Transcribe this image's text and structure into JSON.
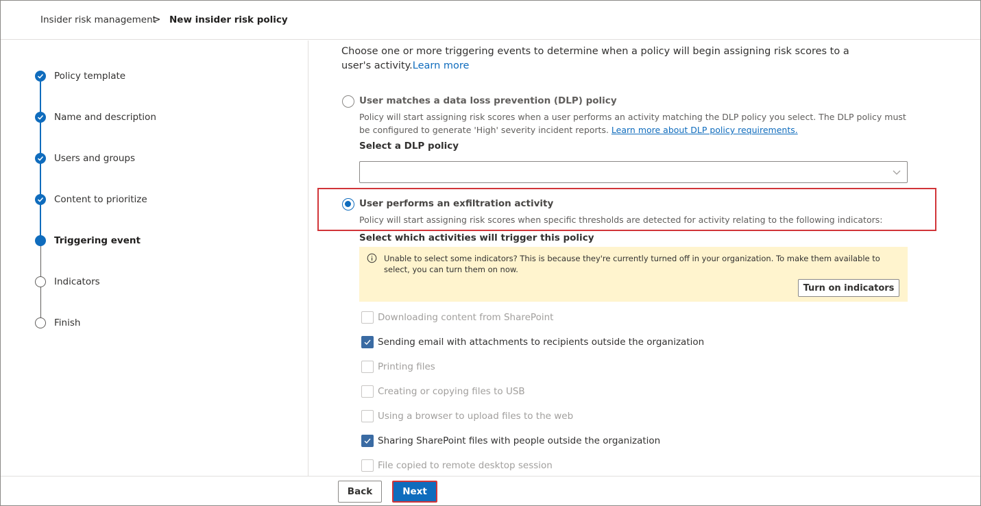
{
  "breadcrumb": {
    "parent": "Insider risk management",
    "separator": ">",
    "current": "New insider risk policy"
  },
  "steps": [
    {
      "label": "Policy template",
      "state": "done"
    },
    {
      "label": "Name and description",
      "state": "done"
    },
    {
      "label": "Users and groups",
      "state": "done"
    },
    {
      "label": "Content to prioritize",
      "state": "done"
    },
    {
      "label": "Triggering event",
      "state": "current"
    },
    {
      "label": "Indicators",
      "state": "todo"
    },
    {
      "label": "Finish",
      "state": "todo"
    }
  ],
  "main": {
    "intro_text": "Choose one or more triggering events to determine when a policy will begin assigning risk scores to a user's activity.",
    "intro_link": "Learn more",
    "option_dlp": {
      "title": "User matches a data loss prevention (DLP) policy",
      "description": "Policy will start assigning risk scores when a user performs an activity matching the DLP policy you select. The DLP policy must be configured to generate 'High' severity incident reports.",
      "link": "Learn more about DLP policy requirements.",
      "selected": false,
      "select_label": "Select a DLP policy",
      "select_value": ""
    },
    "option_exfil": {
      "title": "User performs an exfiltration activity",
      "description": "Policy will start assigning risk scores when specific thresholds are detected for activity relating to the following indicators:",
      "selected": true
    },
    "activities_heading": "Select which activities will trigger this policy",
    "notice": {
      "text": "Unable to select some indicators? This is because they're currently turned off in your organization. To make them available to select, you can turn them on now.",
      "button": "Turn on indicators"
    },
    "activities": [
      {
        "label": "Downloading content from SharePoint",
        "checked": false,
        "enabled": false
      },
      {
        "label": "Sending email with attachments to recipients outside the organization",
        "checked": true,
        "enabled": true
      },
      {
        "label": "Printing files",
        "checked": false,
        "enabled": false
      },
      {
        "label": "Creating or copying files to USB",
        "checked": false,
        "enabled": false
      },
      {
        "label": "Using a browser to upload files to the web",
        "checked": false,
        "enabled": false
      },
      {
        "label": "Sharing SharePoint files with people outside the organization",
        "checked": true,
        "enabled": true
      },
      {
        "label": "File copied to remote desktop session",
        "checked": false,
        "enabled": false
      }
    ]
  },
  "footer": {
    "back_label": "Back",
    "next_label": "Next"
  },
  "colors": {
    "accent": "#0f6cbd",
    "highlight_border": "#d13438",
    "notice_bg": "#fff4ce",
    "checkbox_checked": "#3a6ba3"
  }
}
